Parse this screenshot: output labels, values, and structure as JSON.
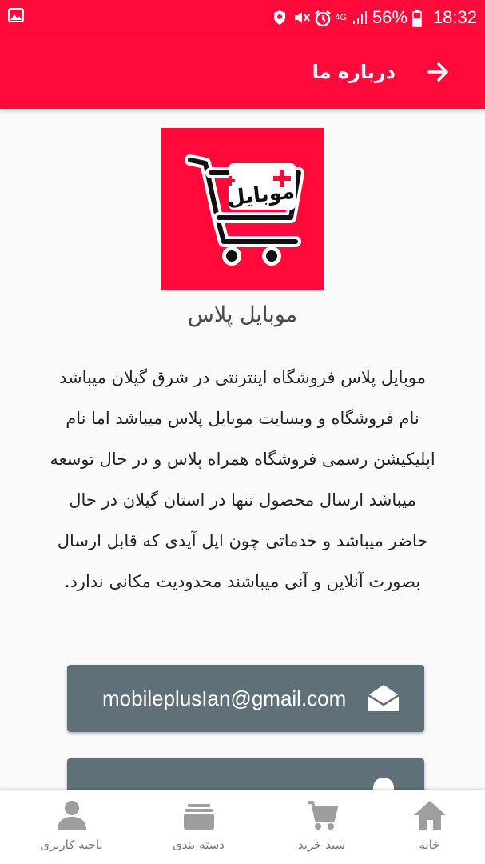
{
  "status_bar": {
    "network": "4G",
    "battery": "56%",
    "time": "18:32",
    "icons": [
      "image-icon",
      "shield-icon",
      "mute-icon",
      "alarm-icon",
      "signal-icon",
      "battery-icon"
    ]
  },
  "app_bar": {
    "title": "درباره ما",
    "back_icon": "arrow-right-icon"
  },
  "about": {
    "app_name": "موبایل پلاس",
    "logo_text": "موبایل",
    "description_lines": [
      "موبایل پلاس فروشگاه اینترنتی در شرق گیلان میباشد",
      "نام فروشگاه و وبسایت  موبایل پلاس میباشد اما نام",
      "اپلیکیشن رسمی فروشگاه همراه پلاس و در حال توسعه",
      "میباشد ارسال محصول تنها در استان گیلان در حال",
      "حاضر میباشد و خدماتی چون اپل آیدی که قابل ارسال",
      "بصورت آنلاین و آنی میباشند محدودیت مکانی ندارد."
    ]
  },
  "contact": {
    "email": "mobileplusIan@gmail.com",
    "email_icon": "envelope-open-icon",
    "second_icon": "location-icon"
  },
  "bottom_nav": {
    "items": [
      {
        "label": "ناحیه کاربری",
        "icon": "user-icon"
      },
      {
        "label": "دسته بندی",
        "icon": "categories-icon"
      },
      {
        "label": "سبد خرید",
        "icon": "cart-icon"
      },
      {
        "label": "خانه",
        "icon": "home-icon"
      }
    ]
  },
  "colors": {
    "primary": "#ff0a3b",
    "button": "#607079",
    "nav_icon": "#9e9e9e"
  }
}
